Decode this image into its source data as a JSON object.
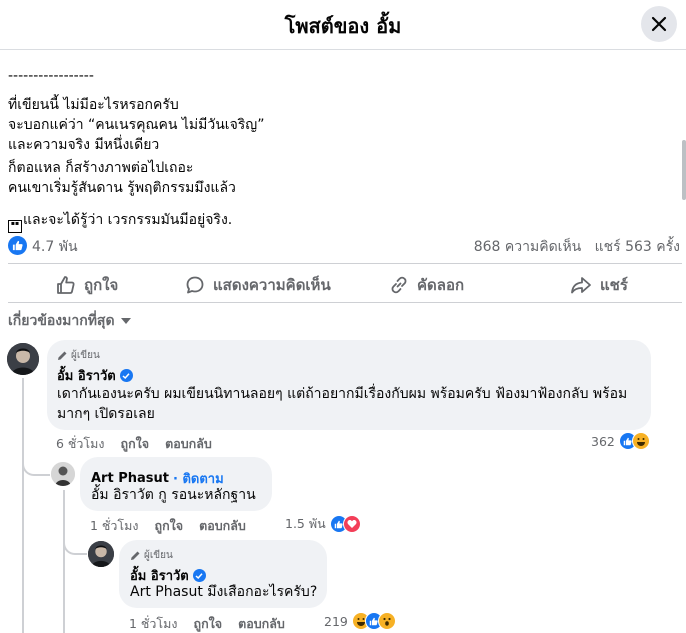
{
  "header": {
    "title": "โพสต์ของ อั้ม"
  },
  "post": {
    "lines": [
      "-----------------",
      "ที่เขียนนี้ ไม่มีอะไรหรอกครับ",
      "จะบอกแค่ว่า “คนเนรคุณคน ไม่มีวันเจริญ”",
      "และความจริง มีหนึ่งเดียว",
      "ก็ตอแหล ก็สร้างภาพต่อไปเถอะ",
      "คนเขาเริ่มรู้สันดาน รู้พฤติกรรมมึงแล้ว",
      "และจะได้รู้ว่า เวรกรรมมันมีอยู่จริง."
    ]
  },
  "stats": {
    "reactions": "4.7 พัน",
    "comments": "868 ความคิดเห็น",
    "shares": "แชร์ 563 ครั้ง"
  },
  "actions": {
    "like": "ถูกใจ",
    "comment": "แสดงความคิดเห็น",
    "copy": "คัดลอก",
    "share": "แชร์"
  },
  "sort": {
    "label": "เกี่ยวข้องมากที่สุด"
  },
  "comments": [
    {
      "badge": "ผู้เขียน",
      "name": "อั้ม อิราวัต",
      "text_lines": [
        "เดากันเองนะครับ ผมเขียนนิทานลอยๆ แต่ถ้าอยากมีเรื่องกับผม พร้อมครับ ฟ้องมาฟ้องกลับ พร้อม",
        "มากๆ เปิดรอเลย"
      ],
      "time": "6 ชั่วโมง",
      "like": "ถูกใจ",
      "reply": "ตอบกลับ",
      "reactions": "362"
    },
    {
      "name": "Art Phasut",
      "follow": "· ติดตาม",
      "text": "อั้ม อิราวัต กู รอนะหลักฐาน",
      "time": "1 ชั่วโมง",
      "like": "ถูกใจ",
      "reply": "ตอบกลับ",
      "reactions": "1.5 พัน"
    },
    {
      "badge": "ผู้เขียน",
      "name": "อั้ม อิราวัต",
      "text": "Art Phasut มึงเสือกอะไรครับ?",
      "time": "1 ชั่วโมง",
      "like": "ถูกใจ",
      "reply": "ตอบกลับ",
      "reactions": "219"
    }
  ],
  "colors": {
    "accent": "#1877f2",
    "secondary_text": "#65676b",
    "bubble": "#f0f2f5"
  }
}
